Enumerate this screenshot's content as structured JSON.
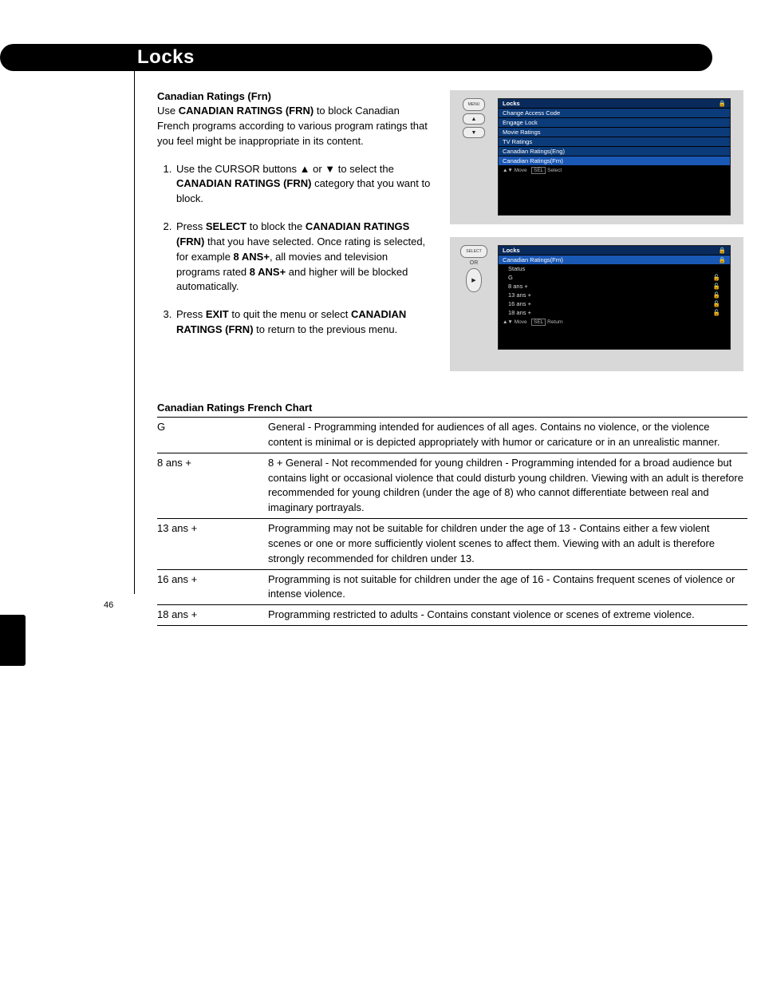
{
  "page_number": "46",
  "title_bar": "Locks",
  "section_heading": "Canadian Ratings (Frn)",
  "intro": {
    "line": "Use CANADIAN RATINGS (FRN) to block Canadian French programs according to various program ratings that you feel might be inappropriate in its content.",
    "prefix": "Use ",
    "bold1": "CANADIAN RATINGS (FRN)",
    "rest": " to block Canadian French programs according to various program ratings that you feel might be inappropriate in its content."
  },
  "steps": {
    "1": {
      "a": "Use the CURSOR buttons ",
      "b1": "▲",
      "mid": " or ",
      "b2": "▼",
      "c": " to select the ",
      "d": "CANADIAN RATINGS (FRN)",
      "e": " category that you want to block."
    },
    "2": {
      "a": "Press ",
      "b": "SELECT",
      "c": " to block the ",
      "d": "CANADIAN RATINGS (FRN)",
      "e": " that you have selected. Once rating is selected, for example ",
      "f": "8 ANS+",
      "g": ", all movies and television programs rated ",
      "h": "8 ANS+",
      "i": " and higher will be blocked automatically."
    },
    "3": {
      "a": "Press ",
      "b": "EXIT",
      "c": " to quit the menu or select ",
      "d": "CANADIAN RATINGS (FRN)",
      "e": " to return to the previous menu."
    }
  },
  "remote": {
    "menu": "MENU",
    "select": "SELECT",
    "or": "OR",
    "up": "▲",
    "down": "▼",
    "right": "▶"
  },
  "osd1": {
    "title": "Locks",
    "items": [
      "Change Access Code",
      "Engage Lock",
      "Movie Ratings",
      "TV Ratings",
      "Canadian Ratings(Eng)",
      "Canadian Ratings(Frn)"
    ],
    "hint_move": "Move",
    "hint_sel": "Select",
    "hint_sel_btn": "SEL",
    "lock_glyph": "🔒"
  },
  "osd2": {
    "title": "Locks",
    "subtitle": "Canadian Ratings(Frn)",
    "status": "Status",
    "rows": [
      "G",
      "8 ans +",
      "13 ans +",
      "16 ans +",
      "18 ans +"
    ],
    "hint_move": "Move",
    "hint_ret": "Return",
    "hint_sel_btn": "SEL",
    "lock_glyph": "🔓"
  },
  "chart_title": "Canadian Ratings French Chart",
  "chart_data": {
    "type": "table",
    "rows": [
      {
        "rating": "G",
        "desc": "General - Programming intended for audiences of all ages. Contains no violence, or the violence content is minimal or is depicted appropriately with humor or caricature or in an unrealistic manner."
      },
      {
        "rating": "8 ans +",
        "desc": "8 + General - Not recommended for young children - Programming intended for a broad audience but contains light or occasional violence that could disturb young children. Viewing with an adult is therefore recommended for young children (under the age of 8) who cannot differentiate between real and imaginary portrayals."
      },
      {
        "rating": "13 ans +",
        "desc": "Programming may not be suitable for children under the age of 13 - Contains either a few violent scenes or one or more sufficiently violent scenes to affect them. Viewing with an adult is therefore strongly recommended for children under 13."
      },
      {
        "rating": "16 ans +",
        "desc": "Programming is not suitable for children under the age of 16 - Contains frequent scenes of violence or intense violence."
      },
      {
        "rating": "18 ans +",
        "desc": "Programming restricted to adults - Contains constant violence or scenes of extreme violence."
      }
    ]
  }
}
